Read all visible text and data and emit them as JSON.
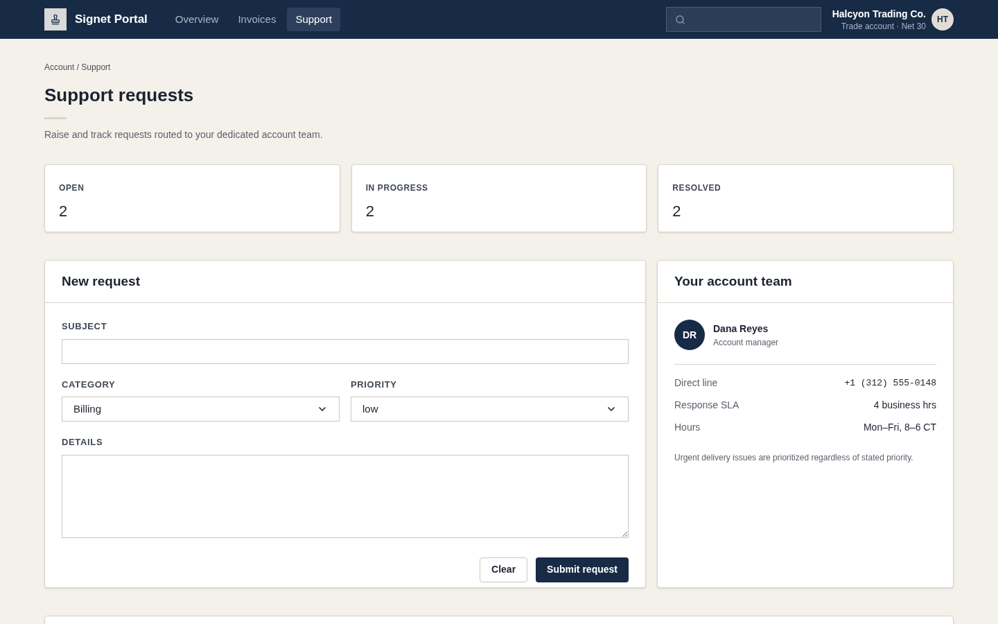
{
  "header": {
    "brand": "Signet Portal",
    "nav": [
      {
        "label": "Overview",
        "selected": false
      },
      {
        "label": "Invoices",
        "selected": false
      },
      {
        "label": "Support",
        "selected": true
      }
    ],
    "account": {
      "name": "Halcyon Trading Co.",
      "detail": "Trade account · Net 30",
      "initials": "HT"
    }
  },
  "breadcrumb": "Account / Support",
  "title": "Support requests",
  "subtitle": "Raise and track requests routed to your dedicated account team.",
  "stats": [
    {
      "label": "OPEN",
      "value": "2"
    },
    {
      "label": "IN PROGRESS",
      "value": "2"
    },
    {
      "label": "RESOLVED",
      "value": "2"
    }
  ],
  "new_request": {
    "title": "New request",
    "subject": {
      "label": "SUBJECT"
    },
    "category": {
      "label": "CATEGORY",
      "value": "Billing"
    },
    "priority": {
      "label": "PRIORITY",
      "value": "low"
    },
    "details": {
      "label": "DETAILS"
    },
    "buttons": [
      {
        "label": "Clear",
        "kind": "secondary"
      },
      {
        "label": "Submit request",
        "kind": "primary"
      }
    ]
  },
  "account_team": {
    "title": "Your account team",
    "manager": {
      "initials": "DR",
      "name": "Dana Reyes",
      "role": "Account manager"
    },
    "rows": [
      {
        "label": "Direct line",
        "value": "+1 (312) 555-0148",
        "kind": "mono"
      },
      {
        "label": "Response SLA",
        "value": "4 business hrs",
        "kind": "text"
      },
      {
        "label": "Hours",
        "value": "Mon–Fri, 8–6 CT",
        "kind": "text"
      }
    ],
    "note": "Urgent delivery issues are prioritized regardless of stated priority."
  }
}
